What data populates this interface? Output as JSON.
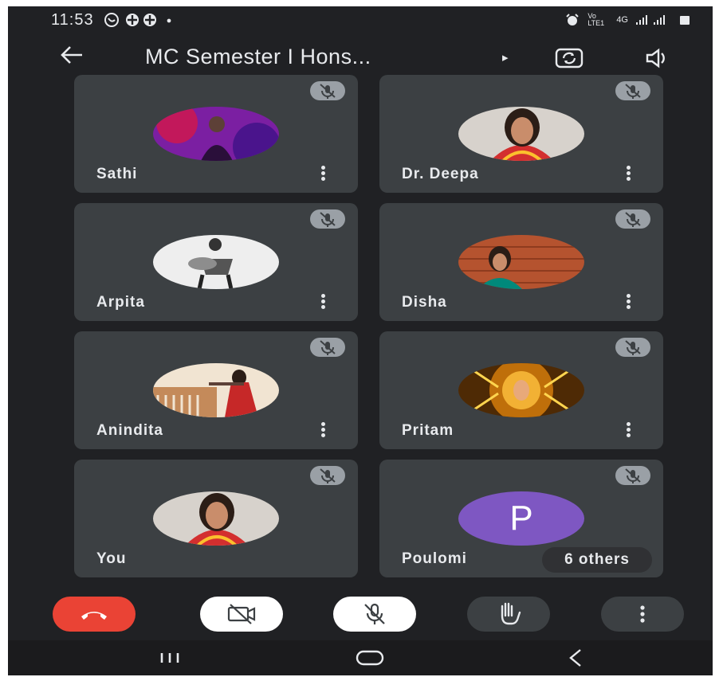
{
  "status_bar": {
    "time": "11:53",
    "network": "4G",
    "volte": "Vo LTE1"
  },
  "app_bar": {
    "title": "MC Semester I Hons...",
    "caret": "▸"
  },
  "participants": [
    {
      "name": "Sathi",
      "avatar": "photo-purple",
      "muted": true
    },
    {
      "name": "Dr. Deepa",
      "avatar": "photo-woman-red-saree",
      "muted": true
    },
    {
      "name": "Arpita",
      "avatar": "photo-guitar-bw",
      "muted": true
    },
    {
      "name": "Disha",
      "avatar": "photo-brick-wall",
      "muted": true
    },
    {
      "name": "Anindita",
      "avatar": "photo-balcony-saree",
      "muted": true
    },
    {
      "name": "Pritam",
      "avatar": "photo-goddess",
      "muted": true
    },
    {
      "name": "You",
      "avatar": "photo-woman-red-saree",
      "muted": true
    },
    {
      "name": "Poulomi",
      "avatar_letter": "P",
      "muted": true
    }
  ],
  "others_chip": "6 others",
  "controls": {
    "end_call": {
      "icon": "end-call-icon",
      "color": "#ea4335"
    },
    "camera": {
      "icon": "camera-off-icon",
      "state": "off"
    },
    "mic": {
      "icon": "mic-off-icon",
      "state": "off"
    },
    "raise_hand": {
      "icon": "raise-hand-icon"
    },
    "more": {
      "icon": "more-vert-icon"
    }
  },
  "colors": {
    "background": "#202124",
    "tile": "#3c4043",
    "end_call": "#ea4335",
    "avatar_letter_bg": "#7e57c2"
  }
}
